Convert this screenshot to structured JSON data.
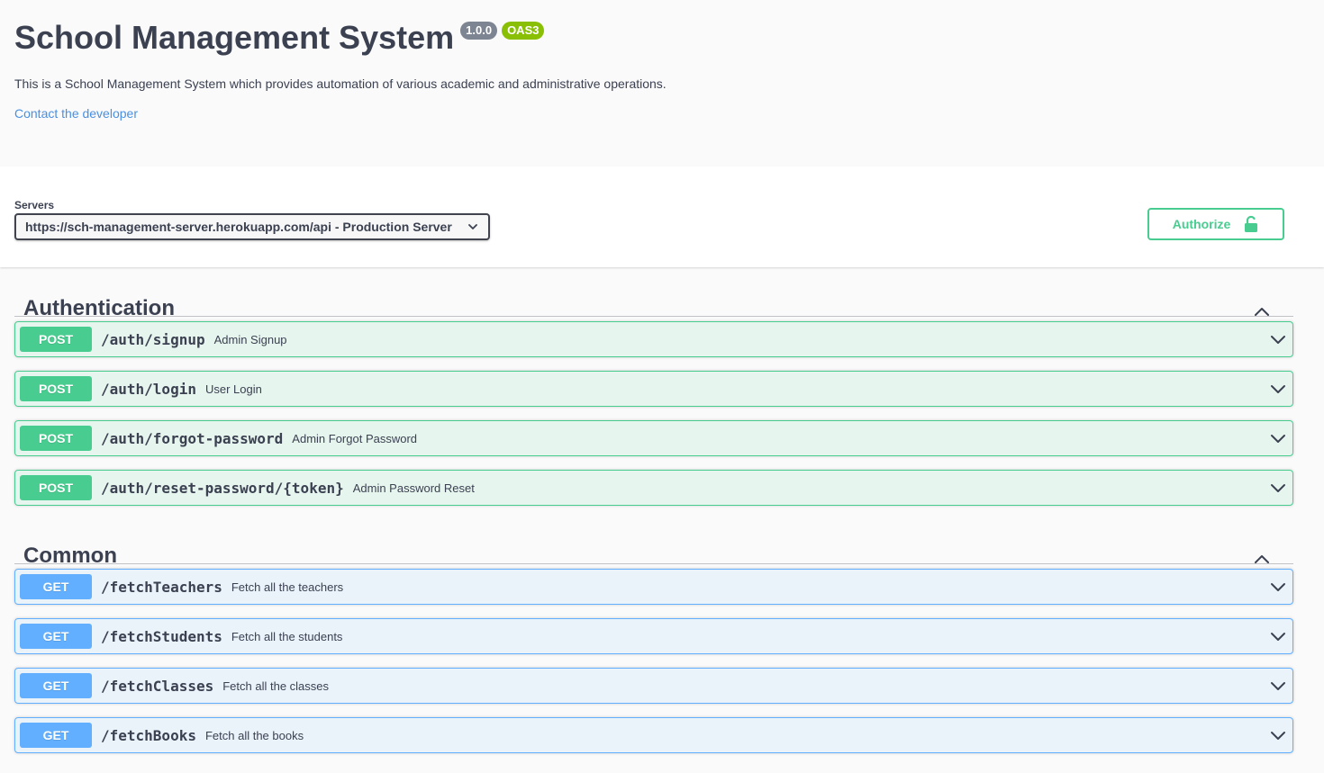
{
  "info": {
    "title": "School Management System",
    "version_badge": "1.0.0",
    "oas_badge": "OAS3",
    "description": "This is a School Management System which provides automation of various academic and administrative operations.",
    "contact_link": "Contact the developer"
  },
  "servers": {
    "label": "Servers",
    "selected": "https://sch-management-server.herokuapp.com/api - Production Server"
  },
  "authorize": {
    "label": "Authorize",
    "icon": "lock-icon"
  },
  "colors": {
    "post": "#49cc90",
    "get": "#61affe",
    "link": "#4990e2",
    "text": "#3b4151"
  },
  "tags": [
    {
      "name": "Authentication",
      "operations": [
        {
          "method": "POST",
          "path": "/auth/signup",
          "summary": "Admin Signup"
        },
        {
          "method": "POST",
          "path": "/auth/login",
          "summary": "User Login"
        },
        {
          "method": "POST",
          "path": "/auth/forgot-password",
          "summary": "Admin Forgot Password"
        },
        {
          "method": "POST",
          "path": "/auth/reset-password/{token}",
          "summary": "Admin Password Reset"
        }
      ]
    },
    {
      "name": "Common",
      "operations": [
        {
          "method": "GET",
          "path": "/fetchTeachers",
          "summary": "Fetch all the teachers"
        },
        {
          "method": "GET",
          "path": "/fetchStudents",
          "summary": "Fetch all the students"
        },
        {
          "method": "GET",
          "path": "/fetchClasses",
          "summary": "Fetch all the classes"
        },
        {
          "method": "GET",
          "path": "/fetchBooks",
          "summary": "Fetch all the books"
        }
      ]
    }
  ]
}
